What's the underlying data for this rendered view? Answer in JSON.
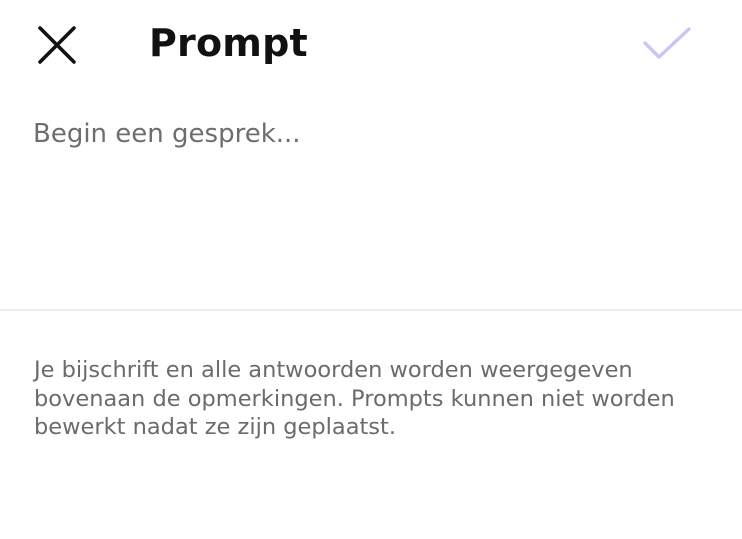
{
  "header": {
    "title": "Prompt",
    "close_icon": "close-icon",
    "confirm_icon": "checkmark-icon"
  },
  "prompt": {
    "placeholder": "Begin een gesprek...",
    "value": ""
  },
  "notice": {
    "text": "Je bijschrift en alle antwoorden worden weergegeven bovenaan de opmerkingen. Prompts kunnen niet worden bewerkt nadat ze zijn geplaatst."
  },
  "colors": {
    "title": "#111111",
    "placeholder": "#6e6e6e",
    "notice": "#6b6b6b",
    "confirm_disabled": "#c9c6f2",
    "divider": "#ebebeb"
  }
}
